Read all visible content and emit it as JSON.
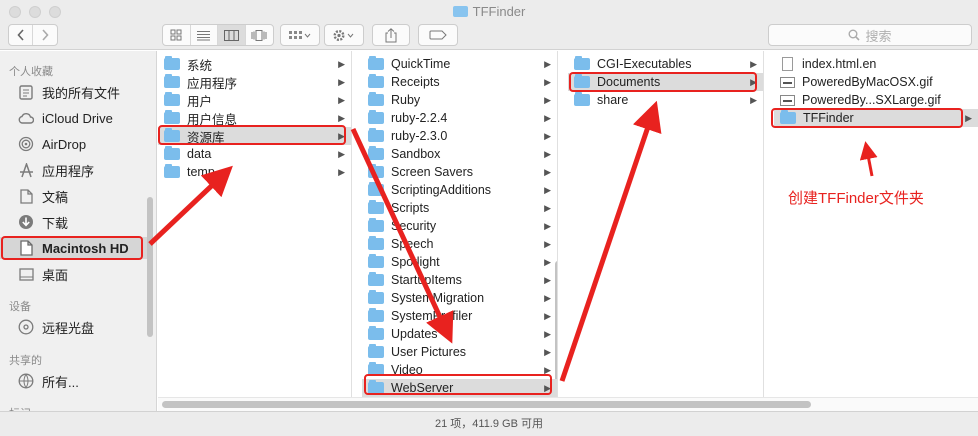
{
  "window": {
    "title": "TFFinder"
  },
  "toolbar": {
    "back_icon": "chevron-left-icon",
    "forward_icon": "chevron-right-icon",
    "search_placeholder": "搜索"
  },
  "sidebar": {
    "favorites_header": "个人收藏",
    "favorites": [
      {
        "label": "我的所有文件",
        "icon": "all-files-icon"
      },
      {
        "label": "iCloud Drive",
        "icon": "cloud-icon"
      },
      {
        "label": "AirDrop",
        "icon": "airdrop-icon"
      },
      {
        "label": "应用程序",
        "icon": "applications-icon"
      },
      {
        "label": "文稿",
        "icon": "documents-icon"
      },
      {
        "label": "下载",
        "icon": "download-icon"
      },
      {
        "label": "Macintosh HD",
        "icon": "hard-drive-icon"
      },
      {
        "label": "桌面",
        "icon": "desktop-icon"
      }
    ],
    "devices_header": "设备",
    "devices": [
      {
        "label": "远程光盘",
        "icon": "disc-icon"
      }
    ],
    "shared_header": "共享的",
    "shared": [
      {
        "label": "所有...",
        "icon": "network-icon"
      }
    ],
    "tags_header": "标记"
  },
  "columns": [
    {
      "items": [
        {
          "label": "系统",
          "has_children": true
        },
        {
          "label": "应用程序",
          "has_children": true
        },
        {
          "label": "用户",
          "has_children": true
        },
        {
          "label": "用户信息",
          "has_children": true
        },
        {
          "label": "资源库",
          "has_children": true,
          "selected": true
        },
        {
          "label": "data",
          "has_children": true
        },
        {
          "label": "temp",
          "has_children": true
        }
      ]
    },
    {
      "items": [
        {
          "label": "QuickTime",
          "has_children": true
        },
        {
          "label": "Receipts",
          "has_children": true
        },
        {
          "label": "Ruby",
          "has_children": true
        },
        {
          "label": "ruby-2.2.4",
          "has_children": true
        },
        {
          "label": "ruby-2.3.0",
          "has_children": true
        },
        {
          "label": "Sandbox",
          "has_children": true
        },
        {
          "label": "Screen Savers",
          "has_children": true
        },
        {
          "label": "ScriptingAdditions",
          "has_children": true
        },
        {
          "label": "Scripts",
          "has_children": true
        },
        {
          "label": "Security",
          "has_children": true
        },
        {
          "label": "Speech",
          "has_children": true
        },
        {
          "label": "Spotlight",
          "has_children": true
        },
        {
          "label": "StartupItems",
          "has_children": true
        },
        {
          "label": "SystemMigration",
          "has_children": true
        },
        {
          "label": "SystemProfiler",
          "has_children": true
        },
        {
          "label": "Updates",
          "has_children": true
        },
        {
          "label": "User Pictures",
          "has_children": true
        },
        {
          "label": "Video",
          "has_children": true
        },
        {
          "label": "WebServer",
          "has_children": true,
          "selected": true
        }
      ]
    },
    {
      "items": [
        {
          "label": "CGI-Executables",
          "has_children": true
        },
        {
          "label": "Documents",
          "has_children": true,
          "selected": true
        },
        {
          "label": "share",
          "has_children": true
        }
      ]
    },
    {
      "items": [
        {
          "label": "index.html.en",
          "kind": "file"
        },
        {
          "label": "PoweredByMacOSX.gif",
          "kind": "gif"
        },
        {
          "label": "PoweredBy...SXLarge.gif",
          "kind": "gif"
        },
        {
          "label": "TFFinder",
          "has_children": true,
          "selected": true
        }
      ]
    }
  ],
  "status": {
    "text": "21 项，411.9 GB 可用"
  },
  "annotation": {
    "note": "创建TFFinder文件夹",
    "color": "#e8221f"
  }
}
